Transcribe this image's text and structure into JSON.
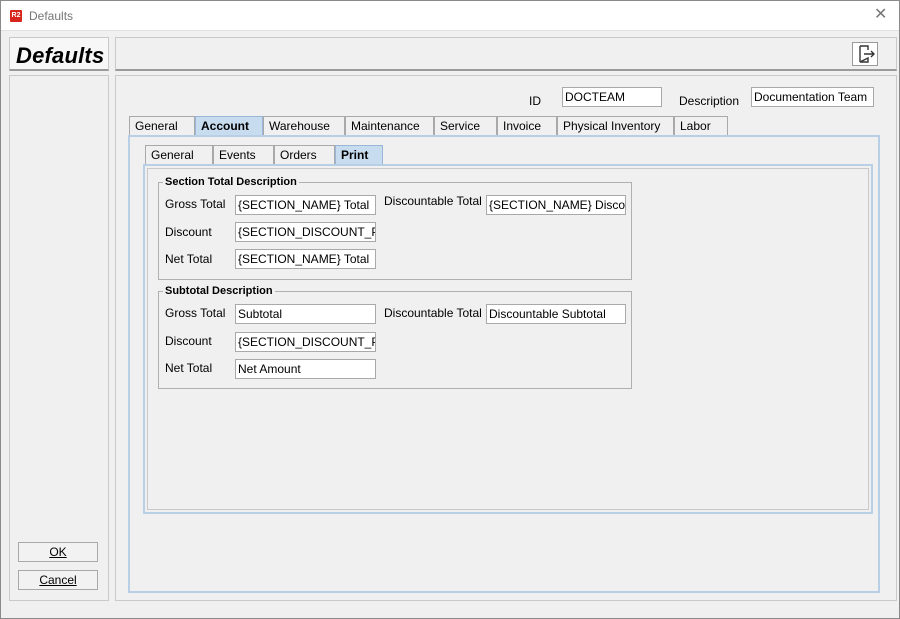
{
  "window": {
    "title": "Defaults",
    "app_icon_text": "R2"
  },
  "left_panel": {
    "heading": "Defaults",
    "ok_label": "OK",
    "cancel_label": "Cancel"
  },
  "header": {
    "id_label": "ID",
    "id_value": "DOCTEAM",
    "description_label": "Description",
    "description_value": "Documentation Team"
  },
  "main_tabs": [
    "General",
    "Account",
    "Warehouse",
    "Maintenance",
    "Service",
    "Invoice",
    "Physical Inventory",
    "Labor"
  ],
  "main_tab_active": "Account",
  "sub_tabs": [
    "General",
    "Events",
    "Orders",
    "Print"
  ],
  "sub_tab_active": "Print",
  "section_total": {
    "title": "Section Total Description",
    "gross_total_label": "Gross Total",
    "gross_total_value": "{SECTION_NAME} Total",
    "discount_label": "Discount",
    "discount_value": "{SECTION_DISCOUNT_PERCENT}",
    "net_total_label": "Net Total",
    "net_total_value": "{SECTION_NAME} Total",
    "discountable_total_label": "Discountable Total",
    "discountable_total_value": "{SECTION_NAME} Discountable Total"
  },
  "subtotal": {
    "title": "Subtotal Description",
    "gross_total_label": "Gross Total",
    "gross_total_value": "Subtotal",
    "discount_label": "Discount",
    "discount_value": "{SECTION_DISCOUNT_PERCENT}",
    "net_total_label": "Net Total",
    "net_total_value": "Net Amount",
    "discountable_total_label": "Discountable Total",
    "discountable_total_value": "Discountable Subtotal"
  },
  "icons": {
    "close": "close-icon",
    "exit": "exit-icon"
  }
}
